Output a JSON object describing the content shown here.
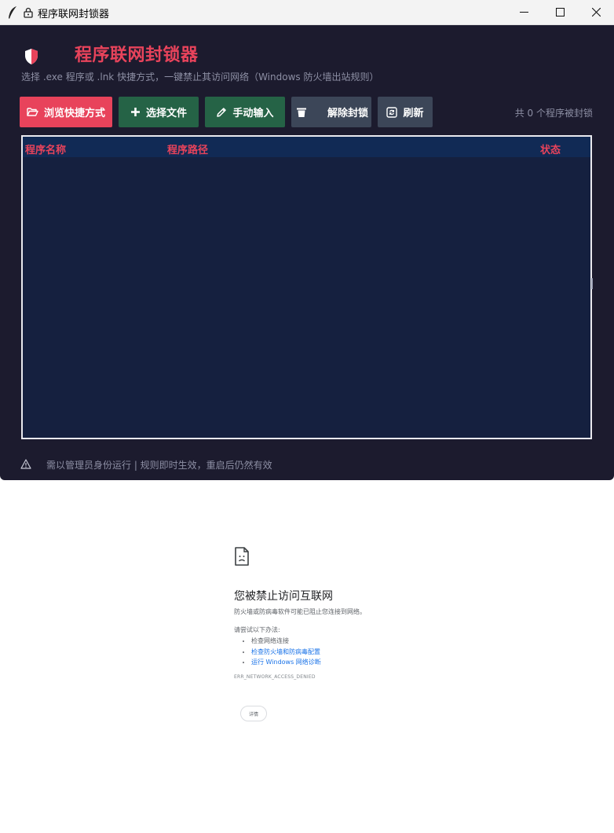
{
  "window": {
    "title": "程序联网封锁器",
    "controls": {
      "minimize": "minimize-icon",
      "maximize": "maximize-icon",
      "close": "close-icon"
    }
  },
  "header": {
    "title": "程序联网封锁器",
    "subtitle": "选择 .exe 程序或 .lnk 快捷方式，一键禁止其访问网络（Windows 防火墙出站规则）"
  },
  "toolbar": {
    "browse_shortcut": "浏览快捷方式",
    "select_file": "选择文件",
    "manual_input": "手动输入",
    "unblock": "解除封锁",
    "refresh": "刷新",
    "count_text": "共 0 个程序被封锁"
  },
  "table": {
    "columns": [
      "程序名称",
      "程序路径",
      "状态"
    ],
    "rows": []
  },
  "footer": {
    "text": "需以管理员身份运行  |  规则即时生效，重启后仍然有效"
  },
  "blocked_page": {
    "title": "您被禁止访问互联网",
    "description": "防火墙或防病毒软件可能已阻止您连接到网络。",
    "try_label": "请尝试以下办法:",
    "suggestions": [
      "检查网络连接",
      "检查防火墙和防病毒配置",
      "运行 Windows 网络诊断"
    ],
    "error_code": "ERR_NETWORK_ACCESS_DENIED",
    "details_button": "详情"
  },
  "colors": {
    "accent": "#e8435b",
    "green_button": "#256346",
    "gray_button": "#3c4658",
    "window_bg": "#1c1b2e",
    "table_bg": "#15203f",
    "table_header_bg": "#112a55",
    "link": "#1a73e8"
  }
}
